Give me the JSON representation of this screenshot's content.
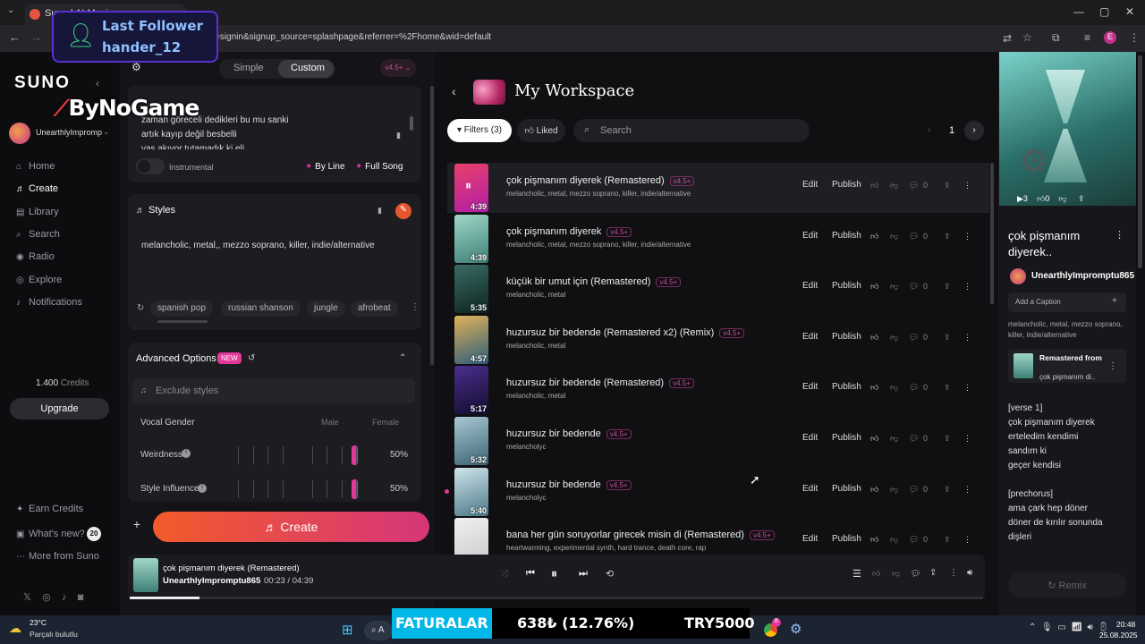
{
  "browser": {
    "tab_title": "Suno | AI Music",
    "url": "=signin&signup_source=splashpage&referrer=%2Fhome&wid=default",
    "profile_initial": "E"
  },
  "overlay": {
    "follower_label": "Last Follower",
    "follower_name": "hander_12",
    "watermark": "ByNoGame"
  },
  "sidebar": {
    "logo": "SUNO",
    "user": "UnearthlyImpromp",
    "nav": [
      {
        "label": "Home",
        "icon": "home-icon"
      },
      {
        "label": "Create",
        "icon": "music-note-icon"
      },
      {
        "label": "Library",
        "icon": "library-icon"
      },
      {
        "label": "Search",
        "icon": "search-icon"
      },
      {
        "label": "Radio",
        "icon": "radio-icon"
      },
      {
        "label": "Explore",
        "icon": "compass-icon"
      },
      {
        "label": "Notifications",
        "icon": "bell-icon"
      }
    ],
    "credits_value": "1.400",
    "credits_label": "Credits",
    "upgrade": "Upgrade",
    "earn": "Earn Credits",
    "whats_new": "What's new?",
    "whats_new_badge": "20",
    "more": "More from Suno"
  },
  "create": {
    "mode_simple": "Simple",
    "mode_custom": "Custom",
    "model": "v4.5+",
    "lyrics": [
      "zaman göreceli dedikleri bu mu sanki",
      "artık kayıp değil besbelli",
      "yas akıyor tutamadık ki eli"
    ],
    "instrumental": "Instrumental",
    "by_line": "By Line",
    "full_song": "Full Song",
    "styles_title": "Styles",
    "styles_text": "melancholic, metal,, mezzo soprano, killer, indie/alternative",
    "style_pills": [
      "spanish pop",
      "russian shanson",
      "jungle",
      "afrobeat"
    ],
    "advanced_title": "Advanced Options",
    "advanced_badge": "NEW",
    "exclude_placeholder": "Exclude styles",
    "vocal_gender": "Vocal Gender",
    "male": "Male",
    "female": "Female",
    "weirdness": "Weirdness",
    "weirdness_value": "50%",
    "style_influence": "Style Influence",
    "style_influence_value": "50%",
    "create_button": "Create"
  },
  "workspace": {
    "title": "My Workspace",
    "filters": "Filters (3)",
    "liked": "Liked",
    "search_placeholder": "Search",
    "page": "1",
    "edit": "Edit",
    "publish": "Publish",
    "rows": [
      {
        "title": "çok pişmanım diyerek (Remastered)",
        "tags": "melancholic, metal, mezzo soprano, killer, indie/alternative",
        "version": "v4.5+",
        "duration": "4:39",
        "count": "0",
        "colors": [
          "#e8406a",
          "#b21ea8"
        ]
      },
      {
        "title": "çok pişmanım diyerek",
        "tags": "melancholic, metal, mezzo soprano, killer, indie/alternative",
        "version": "v4.5+",
        "duration": "4:39",
        "count": "0",
        "colors": [
          "#9fd7c8",
          "#3f7f77"
        ]
      },
      {
        "title": "küçük bir umut için (Remastered)",
        "tags": "melancholic, metal",
        "version": "v4.5+",
        "duration": "5:35",
        "count": "0",
        "colors": [
          "#3a6b63",
          "#0d2421"
        ]
      },
      {
        "title": "huzursuz bir bedende (Remastered x2) (Remix)",
        "tags": "melancholic, metal",
        "version": "v4.5+",
        "duration": "4:57",
        "count": "0",
        "colors": [
          "#e1b25a",
          "#2c5c78"
        ]
      },
      {
        "title": "huzursuz bir bedende (Remastered)",
        "tags": "melancholic, metal",
        "version": "v4.5+",
        "duration": "5:17",
        "count": "0",
        "colors": [
          "#4b2e8f",
          "#120d2c"
        ]
      },
      {
        "title": "huzursuz bir bedende",
        "tags": "melancholyc",
        "version": "v4.5+",
        "duration": "5:32",
        "count": "0",
        "colors": [
          "#a8c8d4",
          "#3d6472"
        ]
      },
      {
        "title": "huzursuz bir bedende",
        "tags": "melancholyc",
        "version": "v4.5+",
        "duration": "5:40",
        "count": "0",
        "colors": [
          "#cfe4ea",
          "#4c7a88"
        ]
      },
      {
        "title": "bana her gün soruyorlar girecek misin di (Remastered)",
        "tags": "heartwarming, experimental synth, hard trance, death core, rap",
        "version": "v4.5+",
        "duration": "",
        "count": "0",
        "colors": [
          "#f0f0f0",
          "#c9c9c9"
        ]
      }
    ]
  },
  "detail": {
    "plays": "3",
    "likes": "0",
    "title_line1": "çok pişmanım",
    "title_line2": "diyerek..",
    "author": "UnearthlyImpromptu865",
    "caption_placeholder": "Add a Caption",
    "tags": "melancholic, metal, mezzo soprano, killer, indie/alternative",
    "remastered_from": "Remastered from",
    "remastered_title": "çok pişmanım di..",
    "lyrics": [
      "[verse 1]",
      "çok pişmanım diyerek",
      "erteledim kendimi",
      "sandım ki",
      "geçer kendisi",
      "",
      "[prechorus]",
      "ama çark hep döner",
      "döner de kırılır sonunda",
      "dişleri"
    ],
    "remix": "Remix"
  },
  "player": {
    "title": "çok pişmanım diyerek (Remastered)",
    "author": "UnearthlyImpromptu865",
    "time": "00:23 / 04:39",
    "progress": 0.082
  },
  "taskbar": {
    "temp": "23°C",
    "weather": "Parçalı bulutlu",
    "ticker_label": "FATURALAR",
    "ticker_price": "638₺ (12.76%)",
    "ticker_try": "TRY5000",
    "time": "20:48",
    "date": "25.08.2025",
    "search_letter": "A",
    "chrome_badge": "8"
  }
}
